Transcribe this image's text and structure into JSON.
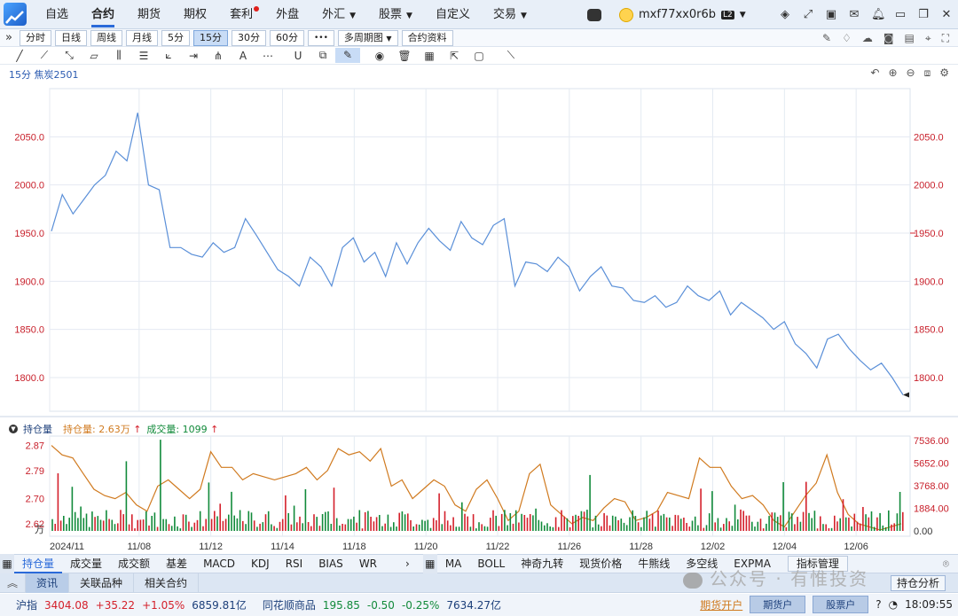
{
  "nav": {
    "items": [
      {
        "label": "自选",
        "active": false,
        "dot": false,
        "caret": false
      },
      {
        "label": "合约",
        "active": true,
        "dot": false,
        "caret": false
      },
      {
        "label": "期货",
        "active": false,
        "dot": false,
        "caret": false
      },
      {
        "label": "期权",
        "active": false,
        "dot": false,
        "caret": false
      },
      {
        "label": "套利",
        "active": false,
        "dot": true,
        "caret": false
      },
      {
        "label": "外盘",
        "active": false,
        "dot": false,
        "caret": false
      },
      {
        "label": "外汇",
        "active": false,
        "dot": false,
        "caret": true
      },
      {
        "label": "股票",
        "active": false,
        "dot": false,
        "caret": true
      },
      {
        "label": "自定义",
        "active": false,
        "dot": false,
        "caret": false
      },
      {
        "label": "交易",
        "active": false,
        "dot": false,
        "caret": true
      }
    ]
  },
  "user": {
    "name": "mxf77xx0r6b",
    "level": "L2"
  },
  "periods": {
    "expand": "»",
    "buttons": [
      {
        "label": "分时",
        "active": false
      },
      {
        "label": "日线",
        "active": false
      },
      {
        "label": "周线",
        "active": false
      },
      {
        "label": "月线",
        "active": false
      },
      {
        "label": "5分",
        "active": false
      },
      {
        "label": "15分",
        "active": true
      },
      {
        "label": "30分",
        "active": false
      },
      {
        "label": "60分",
        "active": false
      }
    ],
    "more": "•••",
    "multi": "多周期图",
    "contract_info": "合约资料"
  },
  "chart_header": {
    "period": "15分",
    "symbol": "焦炭2501"
  },
  "sub_legend": {
    "title": "持仓量",
    "oi_label": "持仓量: 2.63万",
    "vol_label": "成交量: 1099",
    "oi_arrow": "↑",
    "vol_arrow": "↑"
  },
  "chart_data": {
    "type": "line",
    "title": "焦炭2501 15分",
    "price": {
      "yticks": [
        2050.0,
        2000.0,
        1950.0,
        1900.0,
        1850.0,
        1800.0
      ],
      "ylim": [
        1765,
        2100
      ],
      "x_labels": [
        "2024/11",
        "11/08",
        "11/12",
        "11/14",
        "11/18",
        "11/20",
        "11/22",
        "11/26",
        "11/28",
        "12/02",
        "12/04",
        "12/06"
      ],
      "close": [
        1952,
        1990,
        1970,
        1985,
        2000,
        2010,
        2035,
        2025,
        2075,
        2000,
        1995,
        1935,
        1935,
        1928,
        1925,
        1940,
        1930,
        1935,
        1965,
        1948,
        1930,
        1912,
        1905,
        1895,
        1925,
        1915,
        1895,
        1935,
        1945,
        1920,
        1930,
        1905,
        1940,
        1918,
        1940,
        1955,
        1942,
        1932,
        1962,
        1945,
        1938,
        1958,
        1965,
        1895,
        1920,
        1918,
        1910,
        1925,
        1915,
        1890,
        1905,
        1915,
        1895,
        1893,
        1880,
        1878,
        1885,
        1873,
        1878,
        1895,
        1885,
        1880,
        1890,
        1865,
        1878,
        1870,
        1862,
        1850,
        1858,
        1835,
        1825,
        1810,
        1840,
        1845,
        1830,
        1818,
        1808,
        1815,
        1800,
        1782
      ]
    },
    "open_interest": {
      "unit": "万",
      "yticks": [
        2.87,
        2.79,
        2.7,
        2.62
      ],
      "ylim": [
        2.58,
        2.9
      ],
      "values": [
        2.87,
        2.84,
        2.83,
        2.78,
        2.73,
        2.71,
        2.7,
        2.72,
        2.68,
        2.66,
        2.74,
        2.76,
        2.73,
        2.7,
        2.73,
        2.85,
        2.8,
        2.8,
        2.76,
        2.78,
        2.77,
        2.76,
        2.77,
        2.78,
        2.8,
        2.76,
        2.79,
        2.86,
        2.84,
        2.85,
        2.82,
        2.86,
        2.74,
        2.76,
        2.7,
        2.73,
        2.76,
        2.74,
        2.68,
        2.66,
        2.73,
        2.76,
        2.7,
        2.63,
        2.66,
        2.78,
        2.81,
        2.68,
        2.65,
        2.62,
        2.64,
        2.63,
        2.67,
        2.7,
        2.69,
        2.63,
        2.64,
        2.66,
        2.72,
        2.71,
        2.7,
        2.83,
        2.8,
        2.8,
        2.74,
        2.7,
        2.71,
        2.68,
        2.63,
        2.61,
        2.66,
        2.71,
        2.75,
        2.84,
        2.72,
        2.65,
        2.62,
        2.61,
        2.6,
        2.61,
        2.62
      ]
    },
    "volume": {
      "yticks": [
        7536.0,
        5652.0,
        3768.0,
        1884.0,
        0.0
      ],
      "ylim": [
        0,
        7900
      ]
    }
  },
  "indicator_tabs": {
    "left": [
      "持仓量",
      "成交量",
      "成交额",
      "基差",
      "MACD",
      "KDJ",
      "RSI",
      "BIAS",
      "WR"
    ],
    "right": [
      "MA",
      "BOLL",
      "神奇九转",
      "现货价格",
      "牛熊线",
      "多空线",
      "EXPMA"
    ],
    "manage": "指标管理"
  },
  "info_tabs": [
    "资讯",
    "关联品种",
    "相关合约"
  ],
  "status": {
    "index_name": "沪指",
    "index_value": "3404.08",
    "index_change": "+35.22",
    "index_pct": "+1.05%",
    "index_amount": "6859.81亿",
    "sector_name": "同花顺商品",
    "sector_value": "195.85",
    "sector_change": "-0.50",
    "sector_pct": "-0.25%",
    "sector_amount": "7634.27亿",
    "open_futures": "期货开户",
    "futures_account": "期货户",
    "stock_account": "股票户",
    "time": "18:09:55",
    "analysis": "持仓分析"
  },
  "watermark": "公众号 · 有惟投资",
  "colors": {
    "accent": "#2a6ad9",
    "price_line": "#5a8fd8",
    "oi_line": "#d07a1f",
    "up": "#d4202b",
    "down": "#118a3a"
  }
}
